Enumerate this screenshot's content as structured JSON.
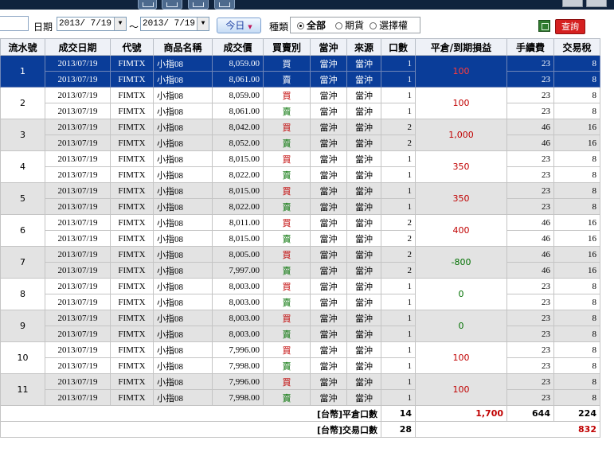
{
  "toolbar": {
    "icons": [
      "grid-icon",
      "calendar-icon",
      "export-icon",
      "add-icon"
    ]
  },
  "filter": {
    "date_label": "日期",
    "date_from": "2013/ 7/19",
    "range_sep": "～",
    "date_to": "2013/ 7/19",
    "today_button": "今日",
    "type_label": "種類",
    "type_options": [
      "全部",
      "期貨",
      "選擇權"
    ],
    "type_selected": "全部",
    "query_button": "查詢"
  },
  "table": {
    "headers": [
      "流水號",
      "成交日期",
      "代號",
      "商品名稱",
      "成交價",
      "買賣別",
      "當沖",
      "來源",
      "口數",
      "平倉/到期損益",
      "手續費",
      "交易稅"
    ],
    "groups": [
      {
        "seq": "1",
        "pnl": "100",
        "selected": true,
        "rows": [
          {
            "date": "2013/07/19",
            "code": "FIMTX",
            "name": "小指08",
            "price": "8,059.00",
            "side": "買",
            "daytrade": "當沖",
            "source": "當沖",
            "qty": "1",
            "fee": "23",
            "tax": "8"
          },
          {
            "date": "2013/07/19",
            "code": "FIMTX",
            "name": "小指08",
            "price": "8,061.00",
            "side": "賣",
            "daytrade": "當沖",
            "source": "當沖",
            "qty": "1",
            "fee": "23",
            "tax": "8"
          }
        ]
      },
      {
        "seq": "2",
        "pnl": "100",
        "rows": [
          {
            "date": "2013/07/19",
            "code": "FIMTX",
            "name": "小指08",
            "price": "8,059.00",
            "side": "買",
            "daytrade": "當沖",
            "source": "當沖",
            "qty": "1",
            "fee": "23",
            "tax": "8"
          },
          {
            "date": "2013/07/19",
            "code": "FIMTX",
            "name": "小指08",
            "price": "8,061.00",
            "side": "賣",
            "daytrade": "當沖",
            "source": "當沖",
            "qty": "1",
            "fee": "23",
            "tax": "8"
          }
        ]
      },
      {
        "seq": "3",
        "pnl": "1,000",
        "rows": [
          {
            "date": "2013/07/19",
            "code": "FIMTX",
            "name": "小指08",
            "price": "8,042.00",
            "side": "買",
            "daytrade": "當沖",
            "source": "當沖",
            "qty": "2",
            "fee": "46",
            "tax": "16"
          },
          {
            "date": "2013/07/19",
            "code": "FIMTX",
            "name": "小指08",
            "price": "8,052.00",
            "side": "賣",
            "daytrade": "當沖",
            "source": "當沖",
            "qty": "2",
            "fee": "46",
            "tax": "16"
          }
        ]
      },
      {
        "seq": "4",
        "pnl": "350",
        "rows": [
          {
            "date": "2013/07/19",
            "code": "FIMTX",
            "name": "小指08",
            "price": "8,015.00",
            "side": "買",
            "daytrade": "當沖",
            "source": "當沖",
            "qty": "1",
            "fee": "23",
            "tax": "8"
          },
          {
            "date": "2013/07/19",
            "code": "FIMTX",
            "name": "小指08",
            "price": "8,022.00",
            "side": "賣",
            "daytrade": "當沖",
            "source": "當沖",
            "qty": "1",
            "fee": "23",
            "tax": "8"
          }
        ]
      },
      {
        "seq": "5",
        "pnl": "350",
        "rows": [
          {
            "date": "2013/07/19",
            "code": "FIMTX",
            "name": "小指08",
            "price": "8,015.00",
            "side": "買",
            "daytrade": "當沖",
            "source": "當沖",
            "qty": "1",
            "fee": "23",
            "tax": "8"
          },
          {
            "date": "2013/07/19",
            "code": "FIMTX",
            "name": "小指08",
            "price": "8,022.00",
            "side": "賣",
            "daytrade": "當沖",
            "source": "當沖",
            "qty": "1",
            "fee": "23",
            "tax": "8"
          }
        ]
      },
      {
        "seq": "6",
        "pnl": "400",
        "rows": [
          {
            "date": "2013/07/19",
            "code": "FIMTX",
            "name": "小指08",
            "price": "8,011.00",
            "side": "買",
            "daytrade": "當沖",
            "source": "當沖",
            "qty": "2",
            "fee": "46",
            "tax": "16"
          },
          {
            "date": "2013/07/19",
            "code": "FIMTX",
            "name": "小指08",
            "price": "8,015.00",
            "side": "賣",
            "daytrade": "當沖",
            "source": "當沖",
            "qty": "2",
            "fee": "46",
            "tax": "16"
          }
        ]
      },
      {
        "seq": "7",
        "pnl": "-800",
        "rows": [
          {
            "date": "2013/07/19",
            "code": "FIMTX",
            "name": "小指08",
            "price": "8,005.00",
            "side": "買",
            "daytrade": "當沖",
            "source": "當沖",
            "qty": "2",
            "fee": "46",
            "tax": "16"
          },
          {
            "date": "2013/07/19",
            "code": "FIMTX",
            "name": "小指08",
            "price": "7,997.00",
            "side": "賣",
            "daytrade": "當沖",
            "source": "當沖",
            "qty": "2",
            "fee": "46",
            "tax": "16"
          }
        ]
      },
      {
        "seq": "8",
        "pnl": "0",
        "rows": [
          {
            "date": "2013/07/19",
            "code": "FIMTX",
            "name": "小指08",
            "price": "8,003.00",
            "side": "買",
            "daytrade": "當沖",
            "source": "當沖",
            "qty": "1",
            "fee": "23",
            "tax": "8"
          },
          {
            "date": "2013/07/19",
            "code": "FIMTX",
            "name": "小指08",
            "price": "8,003.00",
            "side": "賣",
            "daytrade": "當沖",
            "source": "當沖",
            "qty": "1",
            "fee": "23",
            "tax": "8"
          }
        ]
      },
      {
        "seq": "9",
        "pnl": "0",
        "rows": [
          {
            "date": "2013/07/19",
            "code": "FIMTX",
            "name": "小指08",
            "price": "8,003.00",
            "side": "買",
            "daytrade": "當沖",
            "source": "當沖",
            "qty": "1",
            "fee": "23",
            "tax": "8"
          },
          {
            "date": "2013/07/19",
            "code": "FIMTX",
            "name": "小指08",
            "price": "8,003.00",
            "side": "賣",
            "daytrade": "當沖",
            "source": "當沖",
            "qty": "1",
            "fee": "23",
            "tax": "8"
          }
        ]
      },
      {
        "seq": "10",
        "pnl": "100",
        "rows": [
          {
            "date": "2013/07/19",
            "code": "FIMTX",
            "name": "小指08",
            "price": "7,996.00",
            "side": "買",
            "daytrade": "當沖",
            "source": "當沖",
            "qty": "1",
            "fee": "23",
            "tax": "8"
          },
          {
            "date": "2013/07/19",
            "code": "FIMTX",
            "name": "小指08",
            "price": "7,998.00",
            "side": "賣",
            "daytrade": "當沖",
            "source": "當沖",
            "qty": "1",
            "fee": "23",
            "tax": "8"
          }
        ]
      },
      {
        "seq": "11",
        "pnl": "100",
        "rows": [
          {
            "date": "2013/07/19",
            "code": "FIMTX",
            "name": "小指08",
            "price": "7,996.00",
            "side": "買",
            "daytrade": "當沖",
            "source": "當沖",
            "qty": "1",
            "fee": "23",
            "tax": "8"
          },
          {
            "date": "2013/07/19",
            "code": "FIMTX",
            "name": "小指08",
            "price": "7,998.00",
            "side": "賣",
            "daytrade": "當沖",
            "source": "當沖",
            "qty": "1",
            "fee": "23",
            "tax": "8"
          }
        ]
      }
    ],
    "summary_close": {
      "label": "[台幣]平倉口數",
      "qty": "14",
      "pnl": "1,700",
      "fee": "644",
      "tax": "224"
    },
    "summary_trade": {
      "label": "[台幣]交易口數",
      "qty": "28",
      "total": "832"
    }
  },
  "colors": {
    "header_bar": "#10233d",
    "selected_row": "#0a3d99",
    "buy": "#c00000",
    "sell": "#007000",
    "query_button": "#d52020"
  }
}
